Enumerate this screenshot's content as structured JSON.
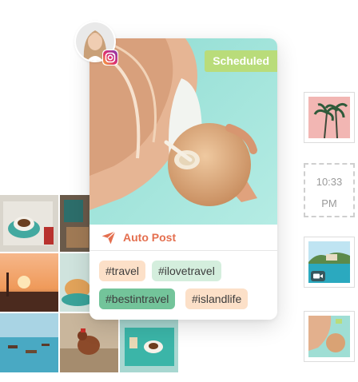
{
  "card": {
    "status_badge": "Scheduled",
    "post_type": "Auto Post",
    "hashtags": [
      "#travel",
      "#ilovetravel",
      "#bestintravel",
      "#islandlife"
    ]
  },
  "side_panel": {
    "time": {
      "hour": "10:33",
      "period": "PM"
    }
  },
  "icons": {
    "avatar_platform": "instagram-icon",
    "post_type": "paper-plane-icon",
    "video_thumb": "video-camera-icon"
  },
  "colors": {
    "scheduled": "#b9dc7a",
    "accent": "#e46f4f",
    "tag_peach": "#fce0c8",
    "tag_mint": "#d4eedd",
    "tag_green": "#73c49a"
  }
}
